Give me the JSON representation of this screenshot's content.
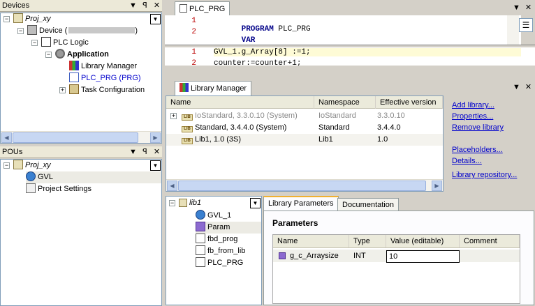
{
  "devices": {
    "title": "Devices",
    "btn_dropdown": "▼",
    "btn_pin": "ᵖ",
    "btn_close": "✕",
    "tree": {
      "project": "Proj_xy",
      "device": "Device (",
      "plc_logic": "PLC Logic",
      "application": "Application",
      "library_manager": "Library Manager",
      "plc_prg": "PLC_PRG (PRG)",
      "task_config": "Task Configuration"
    }
  },
  "pous": {
    "title": "POUs",
    "tree": {
      "project": "Proj_xy",
      "gvl": "GVL",
      "project_settings": "Project Settings"
    }
  },
  "editor": {
    "tab": "PLC_PRG",
    "top_lines": [
      {
        "num": "1",
        "kw": "PROGRAM",
        "rest": " PLC_PRG"
      },
      {
        "num": "2",
        "kw": "VAR",
        "rest": ""
      }
    ],
    "bottom_lines": [
      {
        "num": "1",
        "text": "GVL_1.g_Array[8] :=1;"
      },
      {
        "num": "2",
        "text": "counter:=counter+1;"
      }
    ]
  },
  "library_manager": {
    "tab": "Library Manager",
    "columns": [
      "Name",
      "Namespace",
      "Effective version"
    ],
    "rows": [
      {
        "expander": "+",
        "name": "IoStandard, 3.3.0.10 (System)",
        "namespace": "IoStandard",
        "version": "3.3.0.10",
        "gray": true
      },
      {
        "expander": "",
        "name": "Standard, 3.4.4.0 (System)",
        "namespace": "Standard",
        "version": "3.4.4.0",
        "gray": false
      },
      {
        "expander": "",
        "name": "Lib1, 1.0 (3S)",
        "namespace": "Lib1",
        "version": "1.0",
        "gray": false
      }
    ],
    "links": [
      "Add library...",
      "Properties...",
      "Remove library",
      "Placeholders...",
      "Details...",
      "Library repository..."
    ],
    "lib_tree": {
      "root": "lib1",
      "items": [
        "GVL_1",
        "Param",
        "fbd_prog",
        "fb_from_lib",
        "PLC_PRG"
      ]
    },
    "lib_tabs": [
      "Library Parameters",
      "Documentation"
    ],
    "params": {
      "heading": "Parameters",
      "columns": [
        "Name",
        "Type",
        "Value (editable)",
        "Comment"
      ],
      "row": {
        "name": "g_c_Arraysize",
        "type": "INT",
        "value": "10",
        "comment": ""
      }
    }
  }
}
